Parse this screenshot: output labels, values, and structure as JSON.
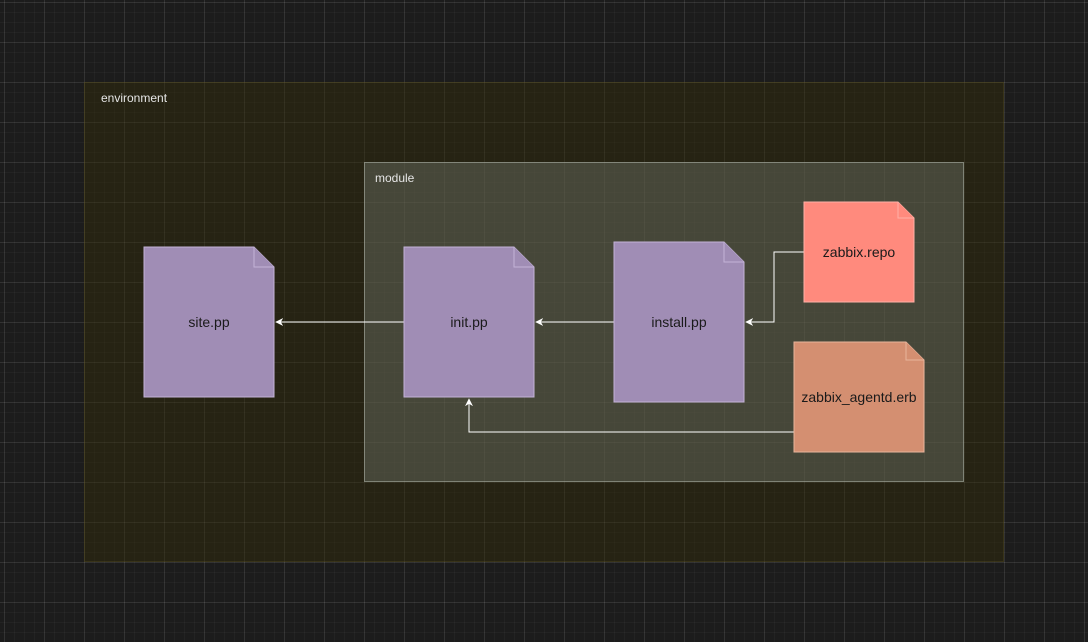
{
  "containers": {
    "environment": {
      "label": "environment"
    },
    "module": {
      "label": "module"
    }
  },
  "nodes": {
    "site": {
      "label": "site.pp",
      "fill": "#a08db5",
      "stroke": "#c3b2d6"
    },
    "init": {
      "label": "init.pp",
      "fill": "#a08db5",
      "stroke": "#c3b2d6"
    },
    "install": {
      "label": "install.pp",
      "fill": "#a08db5",
      "stroke": "#c3b2d6"
    },
    "zabbix_repo": {
      "label": "zabbix.repo",
      "fill": "#ff8a7d",
      "stroke": "#ffb0a6"
    },
    "zabbix_agentd": {
      "label": "zabbix_agentd.erb",
      "fill": "#d48f71",
      "stroke": "#e8b49c"
    }
  },
  "edges": [
    {
      "from": "init.pp",
      "to": "site.pp"
    },
    {
      "from": "install.pp",
      "to": "init.pp"
    },
    {
      "from": "zabbix.repo",
      "to": "install.pp"
    },
    {
      "from": "zabbix_agentd.erb",
      "to": "init.pp"
    }
  ],
  "colors": {
    "edge": "#ffffff",
    "background": "#1c1c1c"
  }
}
